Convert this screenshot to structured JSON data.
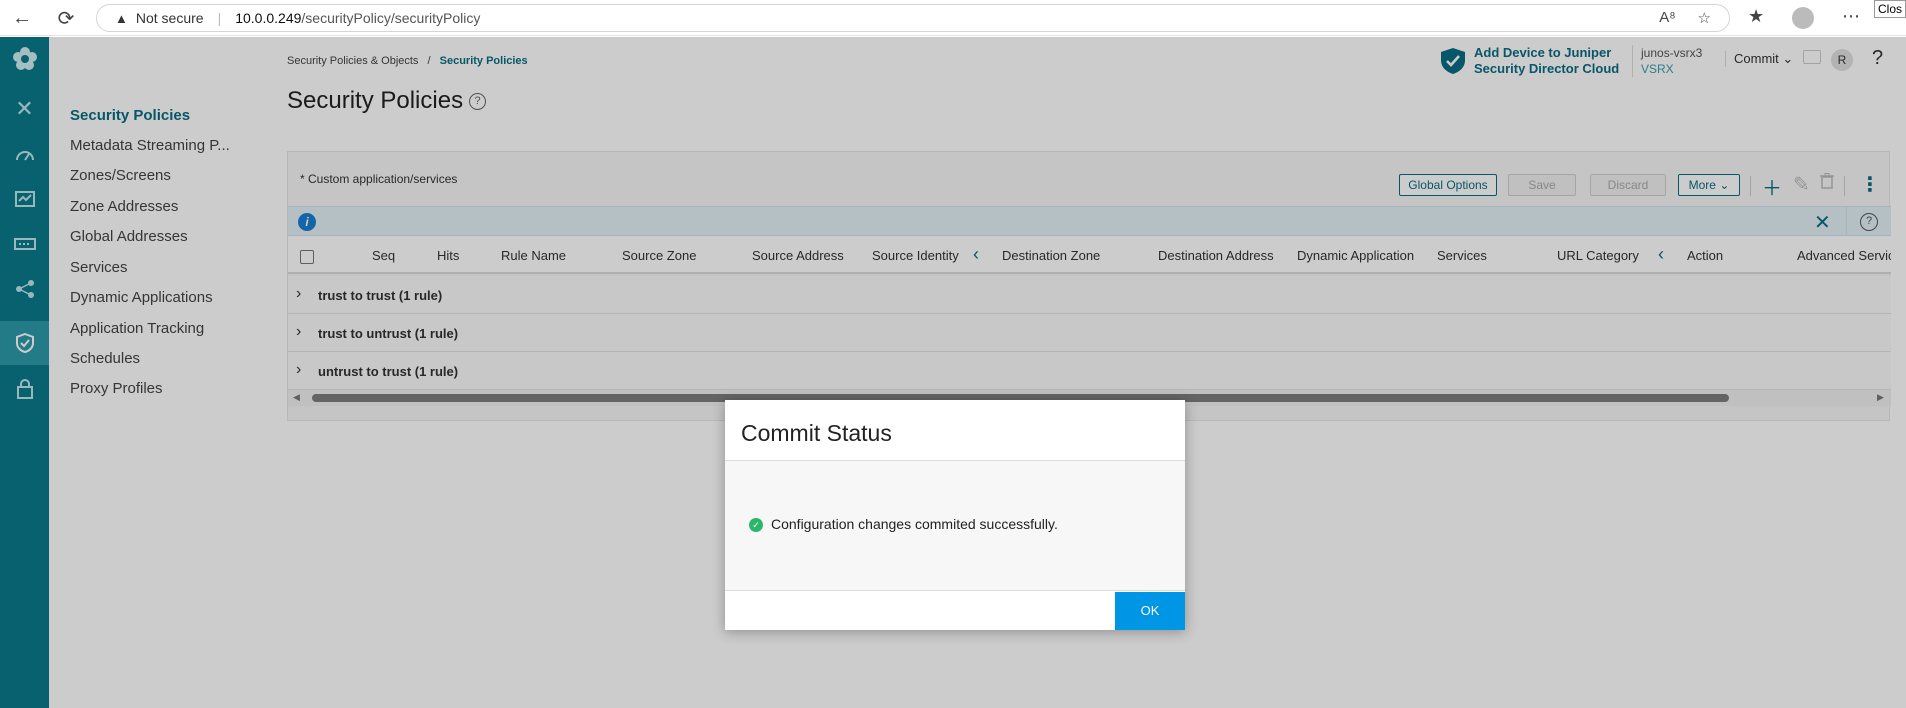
{
  "browser": {
    "not_secure": "Not secure",
    "url_host": "10.0.0.249",
    "url_path": "/securityPolicy/securityPolicy",
    "tooltip": "Clos"
  },
  "nav": {
    "items": [
      {
        "label": "Security Policies",
        "active": true
      },
      {
        "label": "Metadata Streaming P..."
      },
      {
        "label": "Zones/Screens"
      },
      {
        "label": "Zone Addresses"
      },
      {
        "label": "Global Addresses"
      },
      {
        "label": "Services"
      },
      {
        "label": "Dynamic Applications"
      },
      {
        "label": "Application Tracking"
      },
      {
        "label": "Schedules"
      },
      {
        "label": "Proxy Profiles"
      }
    ]
  },
  "header": {
    "breadcrumb_parent": "Security Policies & Objects",
    "breadcrumb_sep": "/",
    "breadcrumb_current": "Security Policies",
    "add_device_line1": "Add Device to Juniper",
    "add_device_line2": "Security Director Cloud",
    "device_name": "junos-vsrx3",
    "device_type": "VSRX",
    "commit_label": "Commit",
    "avatar_initial": "R",
    "help": "?"
  },
  "page": {
    "title": "Security Policies",
    "custom_note": "* Custom application/services"
  },
  "toolbar": {
    "global_options": "Global Options",
    "save": "Save",
    "discard": "Discard",
    "more": "More"
  },
  "table": {
    "columns": [
      "Seq",
      "Hits",
      "Rule Name",
      "Source Zone",
      "Source Address",
      "Source Identity",
      "Destination Zone",
      "Destination Address",
      "Dynamic Application",
      "Services",
      "URL Category",
      "Action",
      "Advanced Servic"
    ],
    "groups": [
      "trust to trust (1 rule)",
      "trust to untrust (1 rule)",
      "untrust to trust (1 rule)"
    ]
  },
  "modal": {
    "title": "Commit Status",
    "message": "Configuration changes commited successfully.",
    "ok": "OK"
  },
  "colors": {
    "rail": "#0b7a8b",
    "accent": "#0b6d83",
    "ok_button": "#0096e6",
    "success": "#2cb66a"
  }
}
